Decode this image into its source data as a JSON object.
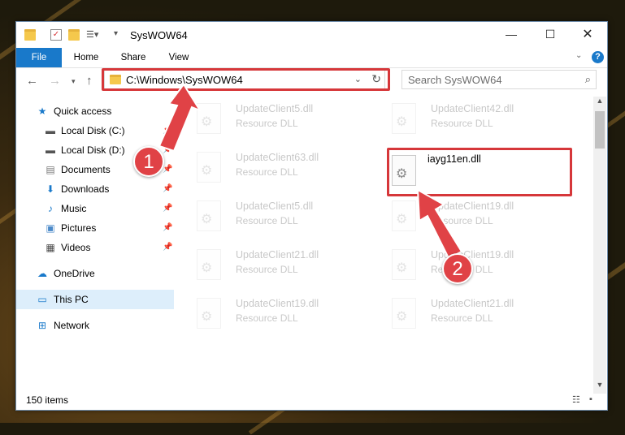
{
  "window": {
    "title": "SysWOW64"
  },
  "ribbon": {
    "tabs": [
      "File",
      "Home",
      "Share",
      "View"
    ]
  },
  "address": {
    "path": "C:\\Windows\\SysWOW64",
    "search_placeholder": "Search SysWOW64"
  },
  "sidebar": {
    "items": [
      {
        "label": "Quick access",
        "icon": "star-icon"
      },
      {
        "label": "Local Disk (C:)",
        "icon": "drive-icon"
      },
      {
        "label": "Local Disk (D:)",
        "icon": "drive-icon"
      },
      {
        "label": "Documents",
        "icon": "documents-icon"
      },
      {
        "label": "Downloads",
        "icon": "download-icon"
      },
      {
        "label": "Music",
        "icon": "music-icon"
      },
      {
        "label": "Pictures",
        "icon": "pictures-icon"
      },
      {
        "label": "Videos",
        "icon": "videos-icon"
      },
      {
        "label": "OneDrive",
        "icon": "cloud-icon"
      },
      {
        "label": "This PC",
        "icon": "computer-icon"
      },
      {
        "label": "Network",
        "icon": "network-icon"
      }
    ]
  },
  "files": {
    "col1": [
      {
        "name": "UpdateClient5.dll",
        "type": "Resource DLL"
      },
      {
        "name": "UpdateClient63.dll",
        "type": "Resource DLL"
      },
      {
        "name": "UpdateClient5.dll",
        "type": "Resource DLL"
      },
      {
        "name": "UpdateClient21.dll",
        "type": "Resource DLL"
      },
      {
        "name": "UpdateClient19.dll",
        "type": "Resource DLL"
      }
    ],
    "col2": [
      {
        "name": "UpdateClient42.dll",
        "type": "Resource DLL"
      },
      {
        "name": "iayg11en.dll",
        "type": ""
      },
      {
        "name": "UpdateClient19.dll",
        "type": "Resource DLL"
      },
      {
        "name": "UpdateClient19.dll",
        "type": "Resource DLL"
      },
      {
        "name": "UpdateClient21.dll",
        "type": "Resource DLL"
      }
    ]
  },
  "status": {
    "count": "150 items"
  },
  "annotations": {
    "badge1": "1",
    "badge2": "2"
  },
  "colors": {
    "accent": "#1979ca",
    "highlight": "#d6373a",
    "selected": "#ddeefb"
  }
}
